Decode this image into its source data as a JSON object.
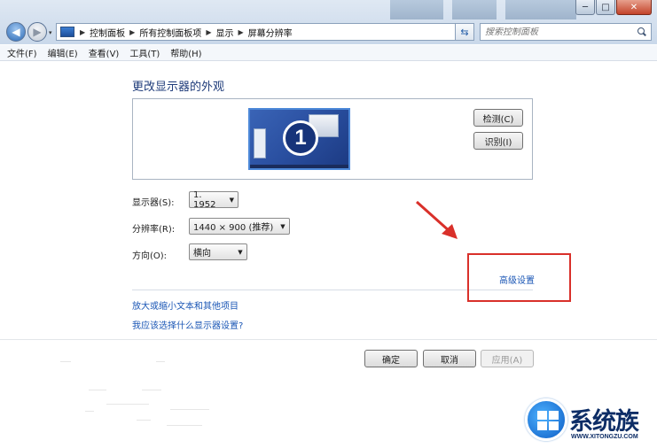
{
  "window": {
    "controls": {
      "minimize": "─",
      "maximize": "□",
      "close": "✕"
    }
  },
  "nav": {
    "back": "◀",
    "forward": "▶",
    "history_dropdown": "▾"
  },
  "address": {
    "breadcrumbs": [
      "控制面板",
      "所有控制面板项",
      "显示",
      "屏幕分辨率"
    ],
    "separator": "▶",
    "dropdown": "▾",
    "refresh": "⇆"
  },
  "search": {
    "placeholder": "搜索控制面板"
  },
  "menu": [
    "文件(F)",
    "编辑(E)",
    "查看(V)",
    "工具(T)",
    "帮助(H)"
  ],
  "main": {
    "title": "更改显示器的外观",
    "monitor_number": "1",
    "detect_button": "检测(C)",
    "identify_button": "识别(I)",
    "display_label": "显示器(S):",
    "display_value": "1. 1952",
    "resolution_label": "分辨率(R):",
    "resolution_value": "1440 × 900 (推荐)",
    "orientation_label": "方向(O):",
    "orientation_value": "横向",
    "advanced_link": "高级设置",
    "link_text_size": "放大或缩小文本和其他项目",
    "link_which_settings": "我应该选择什么显示器设置?"
  },
  "footer": {
    "ok": "确定",
    "cancel": "取消",
    "apply": "应用(A)"
  },
  "watermark": {
    "title": "系统族",
    "url": "WWW.XITONGZU.COM"
  },
  "colors": {
    "accent_link": "#1a56b5",
    "highlight": "#d9302a",
    "title": "#1e3b7a"
  }
}
